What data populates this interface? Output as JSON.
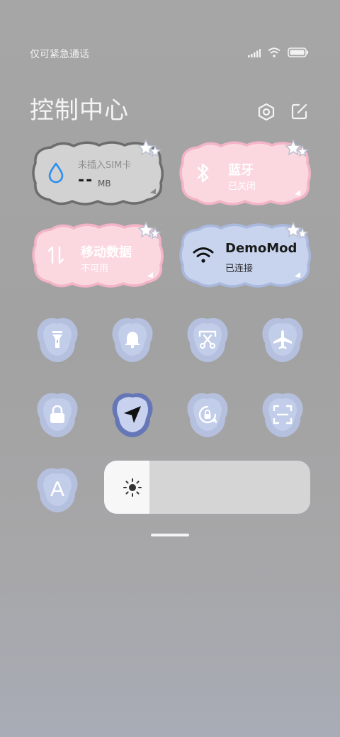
{
  "status_bar": {
    "carrier": "仅可紧急通话",
    "icons": [
      "signal-icon",
      "wifi-icon",
      "battery-icon"
    ]
  },
  "header": {
    "title": "控制中心",
    "settings_icon": "settings-hexagon-icon",
    "edit_icon": "edit-icon"
  },
  "tiles": {
    "data_usage": {
      "label": "未插入SIM卡",
      "value": "--",
      "unit": "MB",
      "icon": "water-drop-icon"
    },
    "bluetooth": {
      "title": "蓝牙",
      "status": "已关闭",
      "icon": "bluetooth-icon"
    },
    "mobile_data": {
      "title": "移动数据",
      "status": "不可用",
      "icon": "mobile-data-arrows-icon"
    },
    "wifi": {
      "title": "DemoMode",
      "status": "已连接",
      "icon": "wifi-icon"
    }
  },
  "toggles_row1": [
    {
      "name": "flashlight",
      "icon": "flashlight-icon"
    },
    {
      "name": "ringer",
      "icon": "bell-icon"
    },
    {
      "name": "screenshot",
      "icon": "scissors-screenshot-icon"
    },
    {
      "name": "airplane",
      "icon": "airplane-icon"
    }
  ],
  "toggles_row2": [
    {
      "name": "lock",
      "icon": "lock-icon"
    },
    {
      "name": "location",
      "icon": "location-arrow-icon"
    },
    {
      "name": "rotation-lock",
      "icon": "rotation-lock-icon"
    },
    {
      "name": "scanner",
      "icon": "scan-icon"
    }
  ],
  "auto_brightness": {
    "label": "A",
    "icon": "auto-brightness-icon"
  },
  "brightness": {
    "level_percent": 22,
    "icon": "sun-icon"
  },
  "colors": {
    "gray_tile": "#d3d3d3",
    "pink_tile": "#fbd8e0",
    "blue_tile": "#c8d4ee",
    "toggle_blob": "#b7c3e4",
    "accent_blue": "#2a8df0"
  }
}
